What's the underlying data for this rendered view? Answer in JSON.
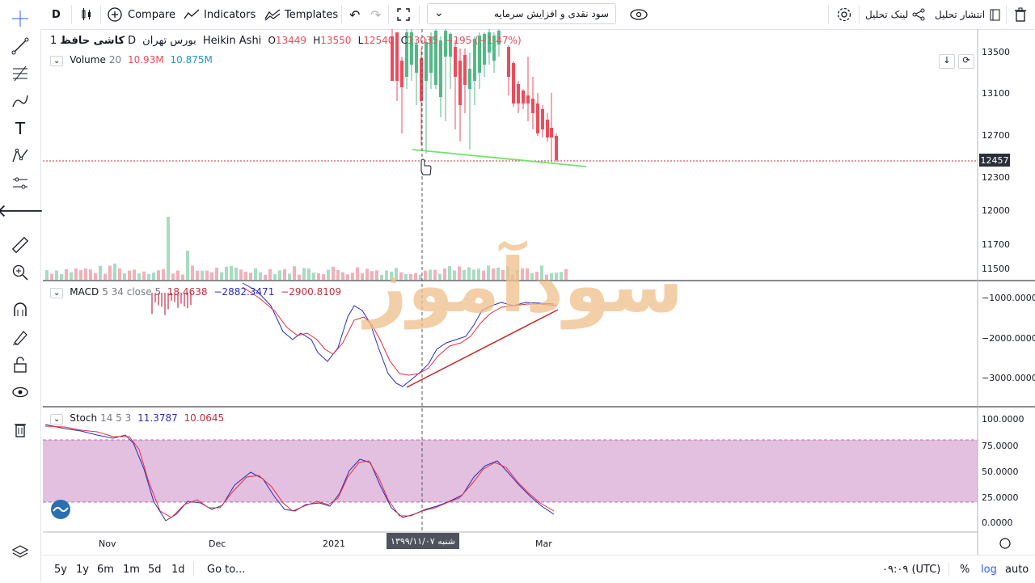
{
  "toolbar": {
    "symbol_short": "D",
    "compare_label": "Compare",
    "indicators_label": "Indicators",
    "templates_label": "Templates",
    "study_template": "سود نقدی و افزایش سرمایه",
    "link_label": "لینک تحلیل",
    "publish_label": "انتشار تحلیل"
  },
  "header": {
    "symbol": "کاشی حافظ",
    "interval": "1D",
    "exchange": "بورس تهران",
    "style": "Heikin Ashi",
    "o_label": "O",
    "o_value": "13449",
    "h_label": "H",
    "h_value": "13550",
    "l_label": "L",
    "l_value": "12540",
    "c_label": "C",
    "c_value": "13035",
    "change": "−195 (−1.47%)"
  },
  "volume_legend": {
    "name": "Volume",
    "param": "20",
    "v1": "10.93M",
    "v2": "10.875M"
  },
  "macd_legend": {
    "name": "MACD",
    "params": "5 34 close 5",
    "v1": "18.4638",
    "v2": "−2882.3471",
    "v3": "−2900.8109"
  },
  "stoch_legend": {
    "name": "Stoch",
    "params": "14 5 3",
    "v1": "11.3787",
    "v2": "10.0645"
  },
  "price_axis": [
    "13500",
    "13100",
    "12700",
    "12300",
    "12000",
    "11700",
    "11500"
  ],
  "current_price": "12457",
  "macd_axis": [
    "−1000.0000",
    "−2000.0000",
    "−3000.0000"
  ],
  "stoch_axis": [
    "100.0000",
    "75.0000",
    "50.0000",
    "25.0000",
    "0.0000"
  ],
  "time_axis": [
    "Nov",
    "Dec",
    "2021",
    "Mar"
  ],
  "crosshair_date": "شنبه ۱۳۹۹/۱۱/۰۷",
  "watermark": "سودآموز",
  "ranges": [
    "5y",
    "1y",
    "6m",
    "1m",
    "5d",
    "1d"
  ],
  "goto_label": "Go to...",
  "clock": "۰۹:۰۹ (UTC)",
  "percent_label": "%",
  "log_label": "log",
  "auto_label": "auto",
  "colors": {
    "up": "#53b987",
    "down": "#eb4d5c",
    "macd": "#2a2eb8",
    "signal": "#e0303e",
    "stoch_band": "#d9a9d5",
    "trend_green": "#76e06c",
    "trend_red": "#c62828",
    "watermark": "#f0c08c"
  }
}
